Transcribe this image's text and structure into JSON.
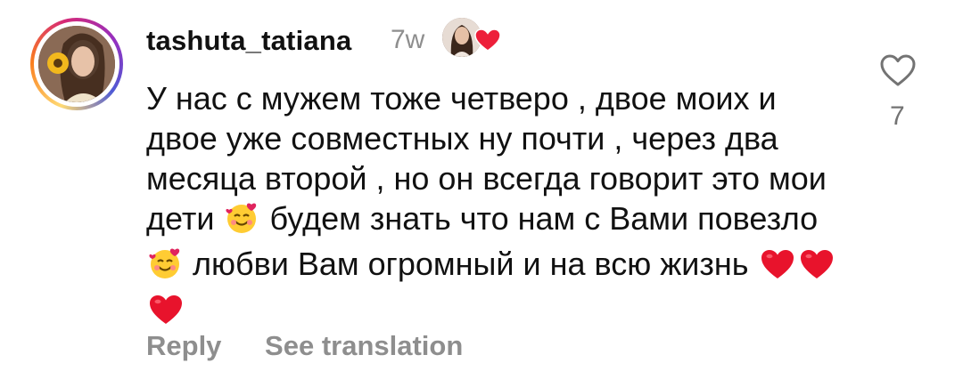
{
  "comment": {
    "username": "tashuta_tatiana",
    "time": "7w",
    "text_parts": [
      "У нас с мужем тоже четверо , двое моих и двое уже совместных ну почти , через два месяца второй , но он всегда говорит это мои дети",
      "будем знать что нам с Вами повезло",
      "любви Вам огромный и на всю жизнь"
    ],
    "emoji": {
      "smile": "smiling-face-with-hearts-icon",
      "heart": "red-heart-icon"
    },
    "like_count": "7",
    "reply_label": "Reply",
    "translate_label": "See translation"
  },
  "colors": {
    "heart_red": "#ed1f3a",
    "muted": "#8e8e8e"
  }
}
